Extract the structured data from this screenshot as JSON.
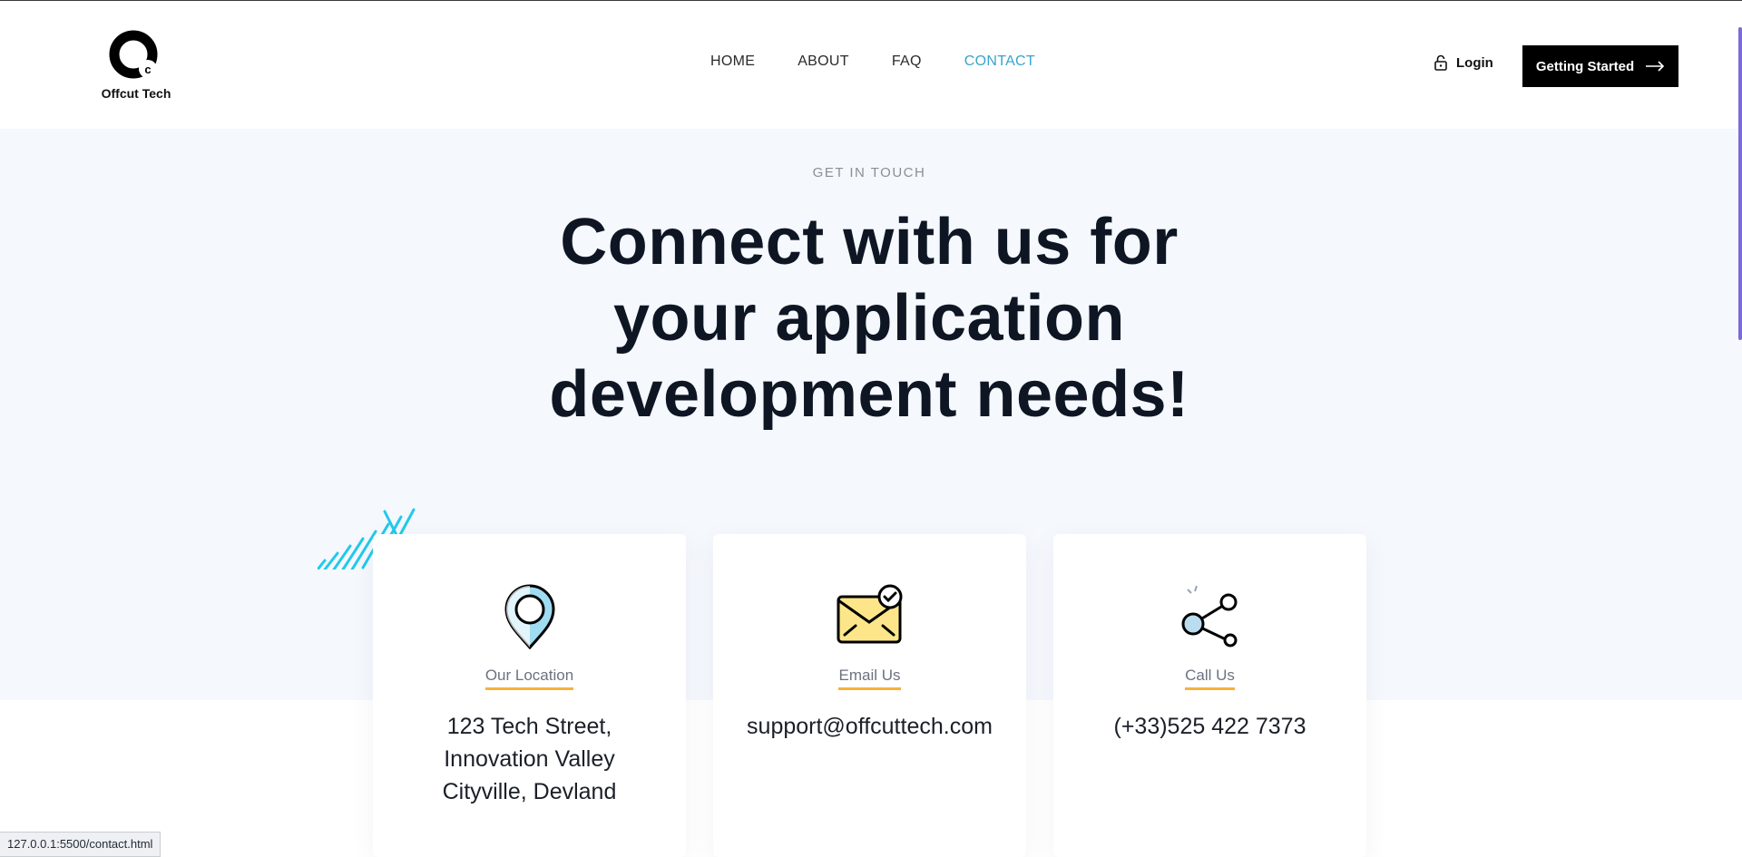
{
  "header": {
    "logo_text": "Offcut Tech",
    "nav": [
      {
        "label": "HOME"
      },
      {
        "label": "ABOUT"
      },
      {
        "label": "FAQ"
      },
      {
        "label": "CONTACT",
        "active": true
      }
    ],
    "login_label": "Login",
    "cta_label": "Getting Started"
  },
  "hero": {
    "eyebrow": "GET IN TOUCH",
    "title_lines": [
      "Connect with us for",
      "your application",
      "development needs!"
    ]
  },
  "cards": [
    {
      "icon": "location-pin-icon",
      "title": "Our Location",
      "value": "123 Tech Street,\nInnovation Valley\nCityville, Devland"
    },
    {
      "icon": "email-check-icon",
      "title": "Email Us",
      "value": "support@offcuttech.com"
    },
    {
      "icon": "share-network-icon",
      "title": "Call Us",
      "value": "(+33)525 422 7373"
    }
  ],
  "status_bar": {
    "url": "127.0.0.1:5500/contact.html"
  },
  "colors": {
    "accent_nav": "#3aa3cc",
    "underline": "#f6b13c",
    "hero_bg": "#f5f8fd",
    "stripes": "#22c9ec",
    "cta_bg": "#000000"
  }
}
